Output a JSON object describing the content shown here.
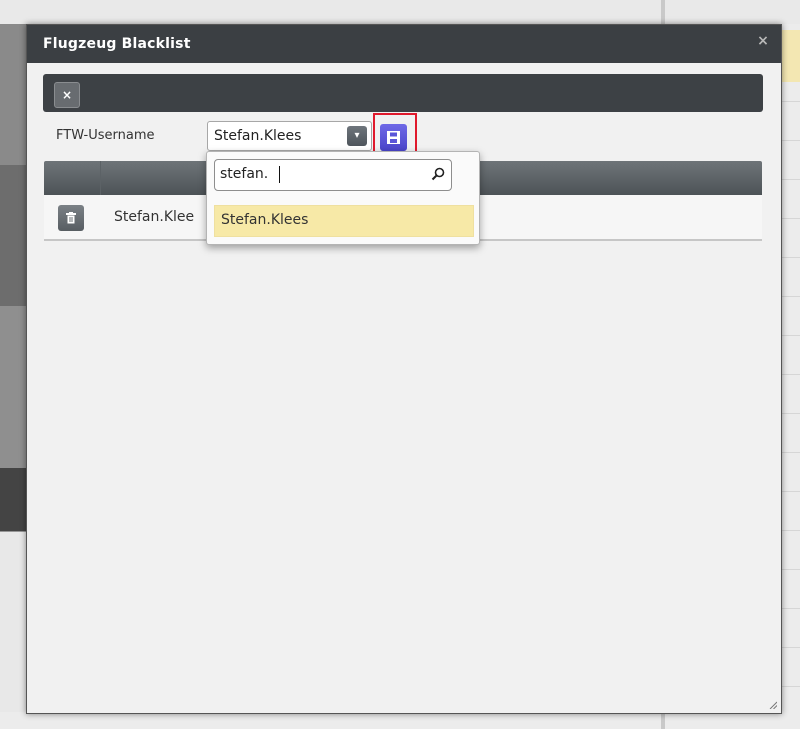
{
  "dialog": {
    "title": "Flugzeug Blacklist",
    "close_glyph": "×"
  },
  "toolbar": {
    "close_glyph": "×"
  },
  "form": {
    "username_label": "FTW-Username",
    "selected_user": "Stefan.Klees",
    "dropdown_arrow": "▾"
  },
  "dropdown": {
    "search_value": "stefan.",
    "options": [
      {
        "label": "Stefan.Klees",
        "highlighted": true
      }
    ]
  },
  "grid": {
    "rows": [
      {
        "user": "Stefan.Klee"
      }
    ]
  },
  "icons": {
    "save": "save-icon",
    "delete": "trash-icon",
    "search": "search-icon"
  },
  "colors": {
    "titlebar": "#3b3f43",
    "save_button": "#5a55d8",
    "highlight_box": "#e0192c",
    "option_highlight": "#f7e9a7"
  }
}
